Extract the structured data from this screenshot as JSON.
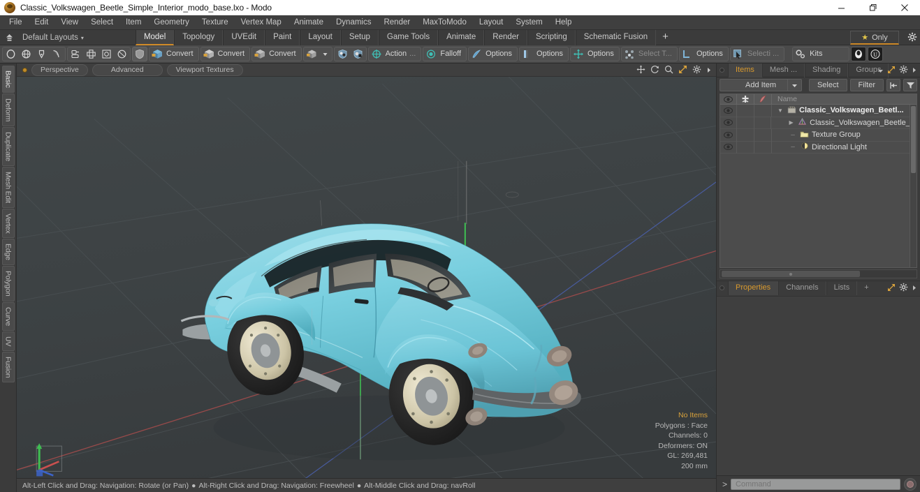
{
  "window": {
    "title": "Classic_Volkswagen_Beetle_Simple_Interior_modo_base.lxo - Modo",
    "app_icon": "modo-app-icon",
    "minimize": "minimize-icon",
    "restore": "restore-icon",
    "close": "close-icon"
  },
  "menubar": {
    "items": [
      {
        "label": "File"
      },
      {
        "label": "Edit"
      },
      {
        "label": "View"
      },
      {
        "label": "Select"
      },
      {
        "label": "Item"
      },
      {
        "label": "Geometry"
      },
      {
        "label": "Texture"
      },
      {
        "label": "Vertex Map"
      },
      {
        "label": "Animate"
      },
      {
        "label": "Dynamics"
      },
      {
        "label": "Render"
      },
      {
        "label": "MaxToModo"
      },
      {
        "label": "Layout"
      },
      {
        "label": "System"
      },
      {
        "label": "Help"
      }
    ]
  },
  "layout_row": {
    "home_icon": "home-layout-icon",
    "layout_name": "Default Layouts",
    "caret": "▾",
    "tabs": [
      {
        "label": "Model",
        "active": true
      },
      {
        "label": "Topology",
        "active": false
      },
      {
        "label": "UVEdit",
        "active": false
      },
      {
        "label": "Paint",
        "active": false
      },
      {
        "label": "Layout",
        "active": false
      },
      {
        "label": "Setup",
        "active": false
      },
      {
        "label": "Game Tools",
        "active": false
      },
      {
        "label": "Animate",
        "active": false
      },
      {
        "label": "Render",
        "active": false
      },
      {
        "label": "Scripting",
        "active": false
      },
      {
        "label": "Schematic Fusion",
        "active": false
      }
    ],
    "add_tab": "+",
    "only_label": "Only",
    "only_star": "★",
    "gear_icon": "gear-icon"
  },
  "toolbar": {
    "shape_icons": [
      "circle-icon",
      "globe-icon",
      "pen-icon",
      "curve-icon"
    ],
    "mesh_icons": [
      "array-icon",
      "cross-icon",
      "square-target-icon",
      "sphere-icon"
    ],
    "shield_icon": "shield-icon",
    "convert_buttons": [
      {
        "label": "Convert",
        "icon": "convert-cube-blue-icon"
      },
      {
        "label": "Convert",
        "icon": "convert-cube-yellow-icon"
      },
      {
        "label": "Convert",
        "icon": "convert-cube-orange-icon"
      }
    ],
    "cube_dropdown": {
      "icon": "cube-icon",
      "caret": "▾"
    },
    "paint_icons": [
      "shield-paint-a-icon",
      "shield-paint-b-icon"
    ],
    "action_button": {
      "label": "Action",
      "icon": "action-center-icon",
      "ellipsis": "..."
    },
    "falloff_button": {
      "label": "Falloff",
      "icon": "falloff-icon"
    },
    "options_buttons": [
      {
        "label": "Options",
        "icon": "options-blue-icon",
        "dim": false
      },
      {
        "label": "Options",
        "icon": "options-bar-icon",
        "dim": false
      },
      {
        "label": "Options",
        "icon": "options-snap-icon",
        "dim": false
      },
      {
        "label": "Select T...",
        "icon": "select-through-icon",
        "dim": true
      },
      {
        "label": "Options",
        "icon": "options-corner-icon",
        "dim": false
      },
      {
        "label": "Selecti ...",
        "icon": "selection-arrow-icon",
        "dim": true
      }
    ],
    "kits_button": {
      "label": "Kits",
      "icon": "kits-gear-icon"
    },
    "right_icons": [
      "modo-badge-icon",
      "unreal-badge-icon"
    ]
  },
  "left_tabs": [
    {
      "label": "Basic",
      "active": true
    },
    {
      "label": "Deform",
      "active": false
    },
    {
      "label": "Duplicate",
      "active": false
    },
    {
      "label": "Mesh Edit",
      "active": false
    },
    {
      "label": "Vertex",
      "active": false
    },
    {
      "label": "Edge",
      "active": false
    },
    {
      "label": "Polygon",
      "active": false
    },
    {
      "label": "Curve",
      "active": false
    },
    {
      "label": "UV",
      "active": false
    },
    {
      "label": "Fusion",
      "active": false
    }
  ],
  "viewport": {
    "header": {
      "dot": "viewport-active-dot",
      "buttons": [
        {
          "label": "Perspective"
        },
        {
          "label": "Advanced"
        },
        {
          "label": "Viewport Textures"
        }
      ],
      "icons": [
        "move-icon",
        "rotate-icon",
        "zoom-icon",
        "maximize-icon",
        "gear-icon",
        "chevron-right-icon"
      ]
    },
    "scene": {
      "model": "classic-volkswagen-beetle",
      "body_color": "#7ecfdd",
      "background_color": "#3d4245",
      "axis_gizmo": "axis-gizmo"
    },
    "hud": {
      "selection": "No Items",
      "polygons": "Polygons : Face",
      "channels": "Channels: 0",
      "deformers": "Deformers: ON",
      "gl": "GL: 269,481",
      "grid": "200 mm"
    }
  },
  "statusbar": {
    "segments": [
      "Alt-Left Click and Drag: Navigation: Rotate (or Pan)",
      "Alt-Right Click and Drag: Navigation: Freewheel",
      "Alt-Middle Click and Drag: navRoll"
    ],
    "separator": "●"
  },
  "right_panel": {
    "tabs": [
      {
        "label": "Items",
        "active": true
      },
      {
        "label": "Mesh ...",
        "active": false
      },
      {
        "label": "Shading",
        "active": false
      },
      {
        "label": "Groups",
        "active": false
      }
    ],
    "tab_icons": [
      "chevron-down-icon",
      "maximize-icon",
      "gear-icon",
      "chevron-right-icon"
    ],
    "toolbar": {
      "add_item": "Add Item",
      "add_item_caret": "▾",
      "select": "Select",
      "filter": "Filter",
      "collapse_icon": "collapse-left-icon",
      "funnel_icon": "funnel-icon"
    },
    "list": {
      "columns": [
        {
          "icon": "eye-icon"
        },
        {
          "icon": "deformer-icon"
        },
        {
          "icon": "render-icon"
        },
        {
          "label": "Name"
        }
      ],
      "rows": [
        {
          "name": "Classic_Volkswagen_Beetl...",
          "icon": "mesh-group-icon",
          "depth": 0,
          "twisty": "▼",
          "bold": true
        },
        {
          "name": "Classic_Volkswagen_Beetle_...",
          "icon": "mesh-icon",
          "depth": 1,
          "twisty": "▶",
          "bold": false
        },
        {
          "name": "Texture Group",
          "icon": "texture-group-icon",
          "depth": 1,
          "twisty": "",
          "bold": false
        },
        {
          "name": "Directional Light",
          "icon": "light-icon",
          "depth": 1,
          "twisty": "",
          "bold": false
        }
      ]
    },
    "properties": {
      "tabs": [
        {
          "label": "Properties",
          "active": true
        },
        {
          "label": "Channels",
          "active": false
        },
        {
          "label": "Lists",
          "active": false
        }
      ],
      "add_tab": "+",
      "icons": [
        "maximize-icon",
        "gear-icon",
        "chevron-right-icon"
      ]
    }
  },
  "command_bar": {
    "prompt": ">",
    "placeholder": "Command",
    "value": "",
    "record_icon": "record-icon"
  }
}
